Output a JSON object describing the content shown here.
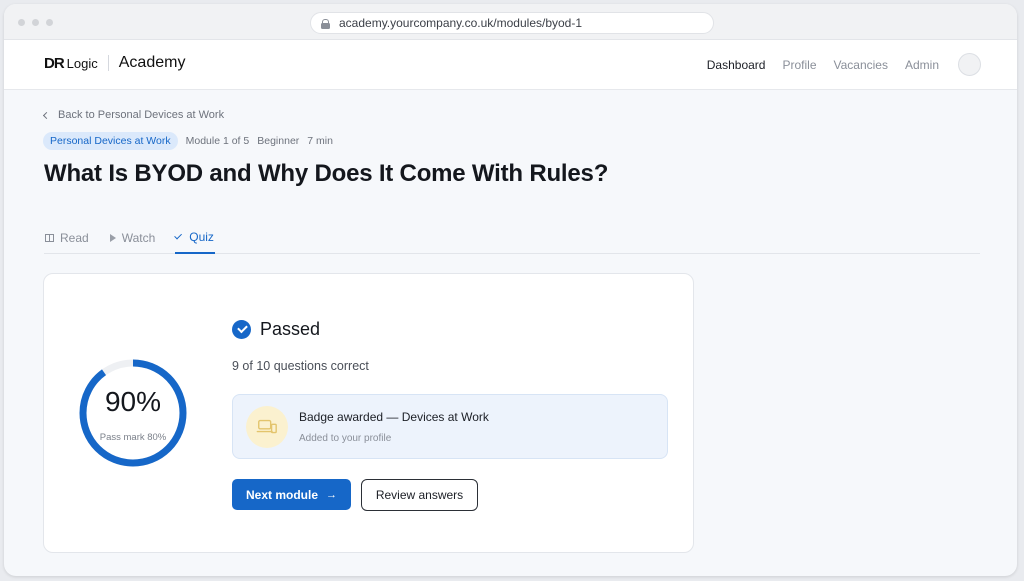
{
  "browser": {
    "url": "academy.yourcompany.co.uk/modules/byod-1"
  },
  "brand": {
    "mark": "DR",
    "logic": "Logic",
    "academy": "Academy"
  },
  "nav": {
    "items": [
      {
        "label": "Dashboard",
        "active": true
      },
      {
        "label": "Profile",
        "active": false
      },
      {
        "label": "Vacancies",
        "active": false
      },
      {
        "label": "Admin",
        "active": false
      }
    ]
  },
  "breadcrumb": {
    "back_label": "Back to Personal Devices at Work"
  },
  "meta": {
    "course": "Personal Devices at Work",
    "module": "Module 1 of 5",
    "level": "Beginner",
    "duration": "7 min"
  },
  "page": {
    "title": "What Is BYOD and Why Does It Come With Rules?"
  },
  "tabs": [
    {
      "label": "Read",
      "icon": "book-icon",
      "active": false
    },
    {
      "label": "Watch",
      "icon": "play-icon",
      "active": false
    },
    {
      "label": "Quiz",
      "icon": "check-icon",
      "active": true
    }
  ],
  "result": {
    "score_percent_label": "90%",
    "score_fraction": 0.9,
    "pass_mark_label": "Pass mark 80%",
    "status": "Passed",
    "summary": "9 of 10 questions correct",
    "badge": {
      "title": "Badge awarded — Devices at Work",
      "subtitle": "Added to your profile",
      "icon": "badge-icon"
    },
    "primary_action": "Next module",
    "secondary_action": "Review answers"
  },
  "colors": {
    "accent": "#1667c8",
    "chip_bg": "#dbe9fb",
    "badge_bg": "#edf3fc",
    "badge_icon_bg": "#fbf1cf"
  }
}
